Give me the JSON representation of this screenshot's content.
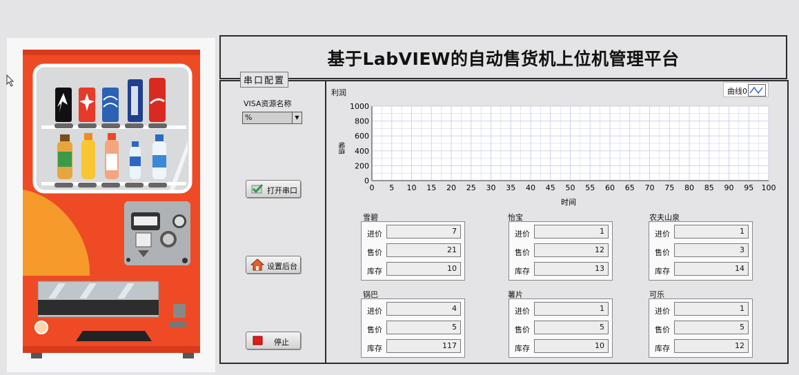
{
  "title": "基于LabVIEW的自动售货机上位机管理平台",
  "serial": {
    "section_label": "串口配置",
    "visa_label": "VISA资源名称",
    "visa_value": "%"
  },
  "buttons": {
    "open_port": "打开串口",
    "settings": "设置后台",
    "stop": "停止"
  },
  "chart": {
    "title": "利润",
    "legend": "曲线0",
    "xlabel": "时间",
    "ylabel": "幅值"
  },
  "chart_data": {
    "type": "line",
    "title": "利润",
    "xlabel": "时间",
    "ylabel": "幅值",
    "xlim": [
      0,
      100
    ],
    "ylim": [
      0,
      1000
    ],
    "x_ticks": [
      "0",
      "5",
      "10",
      "15",
      "20",
      "25",
      "30",
      "35",
      "40",
      "45",
      "50",
      "55",
      "60",
      "65",
      "70",
      "75",
      "80",
      "85",
      "90",
      "95",
      "100"
    ],
    "y_ticks": [
      "0",
      "200",
      "400",
      "600",
      "800",
      "1000"
    ],
    "grid": true,
    "legend_position": "top-right",
    "series": [
      {
        "name": "曲线0",
        "values": []
      }
    ]
  },
  "products": [
    {
      "name": "雪碧",
      "rows": [
        {
          "k": "进价",
          "v": "7"
        },
        {
          "k": "售价",
          "v": "21"
        },
        {
          "k": "库存",
          "v": "10"
        }
      ]
    },
    {
      "name": "怡宝",
      "rows": [
        {
          "k": "进价",
          "v": "1"
        },
        {
          "k": "售价",
          "v": "12"
        },
        {
          "k": "库存",
          "v": "13"
        }
      ]
    },
    {
      "name": "农夫山泉",
      "rows": [
        {
          "k": "进价",
          "v": "1"
        },
        {
          "k": "售价",
          "v": "3"
        },
        {
          "k": "库存",
          "v": "14"
        }
      ]
    },
    {
      "name": "锅巴",
      "rows": [
        {
          "k": "进价",
          "v": "4"
        },
        {
          "k": "售价",
          "v": "5"
        },
        {
          "k": "库存",
          "v": "117"
        }
      ]
    },
    {
      "name": "薯片",
      "rows": [
        {
          "k": "进价",
          "v": "1"
        },
        {
          "k": "售价",
          "v": "5"
        },
        {
          "k": "库存",
          "v": "10"
        }
      ]
    },
    {
      "name": "可乐",
      "rows": [
        {
          "k": "进价",
          "v": "1"
        },
        {
          "k": "售价",
          "v": "5"
        },
        {
          "k": "库存",
          "v": "12"
        }
      ]
    }
  ],
  "colors": {
    "machine_body": "#ee4a25",
    "machine_accent": "#f59a2b",
    "panel_bg": "#e4e3e5",
    "grid": "#c9cde6"
  }
}
